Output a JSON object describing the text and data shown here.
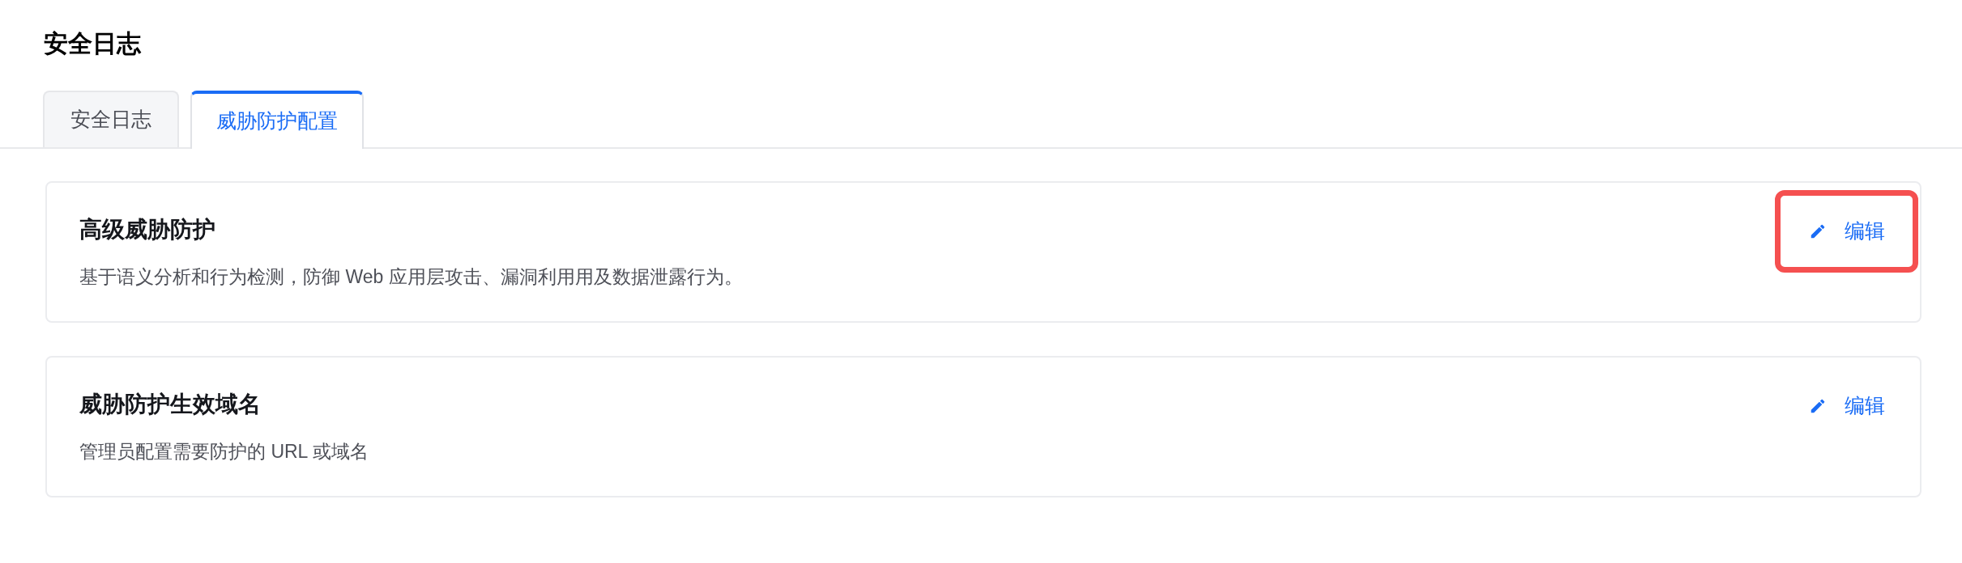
{
  "page_title": "安全日志",
  "tabs": [
    {
      "label": "安全日志",
      "selected": false
    },
    {
      "label": "威胁防护配置",
      "selected": true
    }
  ],
  "cards": [
    {
      "title": "高级威胁防护",
      "description": "基于语义分析和行为检测，防御 Web 应用层攻击、漏洞利用用及数据泄露行为。",
      "action": {
        "label": "编辑",
        "highlighted": true
      }
    },
    {
      "title": "威胁防护生效域名",
      "description": "管理员配置需要防护的 URL 或域名",
      "action": {
        "label": "编辑",
        "highlighted": false
      }
    }
  ]
}
